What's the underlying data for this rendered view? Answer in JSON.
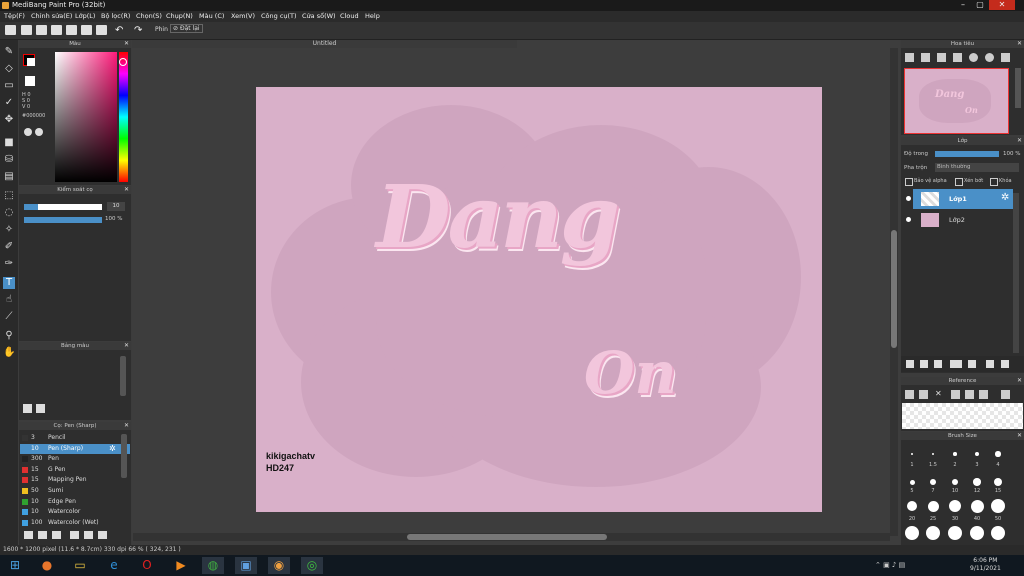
{
  "window": {
    "title": "MediBang Paint Pro (32bit)"
  },
  "menu": [
    "Tệp(F)",
    "Chỉnh sửa(E)",
    "Lớp(L)",
    "Bộ lọc(R)",
    "Chọn(S)",
    "Chụp(N)",
    "Màu (C)",
    "Xem(V)",
    "Công cụ(T)",
    "Cửa sổ(W)",
    "Cloud",
    "Help"
  ],
  "toolbar": {
    "prev_label": "Phin",
    "invert_label": "Đặt lại"
  },
  "document": {
    "tab_title": "Untitled"
  },
  "color_panel": {
    "title": "Màu",
    "hsv": [
      "H 0",
      "S 0",
      "V 0"
    ],
    "hex": "#000000",
    "colors": {
      "primary": "#000000",
      "secondary": "#ffffff",
      "accent": "#4a90c8"
    }
  },
  "brush_control": {
    "title": "Kiểm soát cọ",
    "size_value": "10",
    "opacity_value": "100 %"
  },
  "palette_panel": {
    "title": "Bảng màu"
  },
  "brush_panel": {
    "title": "Cọ: Pen (Sharp)",
    "items": [
      {
        "size": "3",
        "name": "Pencil",
        "color": "#333333"
      },
      {
        "size": "10",
        "name": "Pen (Sharp)",
        "color": "#4a90c8"
      },
      {
        "size": "300",
        "name": "Pen",
        "color": "#222222"
      },
      {
        "size": "15",
        "name": "G Pen",
        "color": "#e03030"
      },
      {
        "size": "15",
        "name": "Mapping Pen",
        "color": "#e03030"
      },
      {
        "size": "50",
        "name": "Sumi",
        "color": "#f0c020"
      },
      {
        "size": "10",
        "name": "Edge Pen",
        "color": "#30a030"
      },
      {
        "size": "10",
        "name": "Watercolor",
        "color": "#40a0e0"
      },
      {
        "size": "100",
        "name": "Watercolor (Wet)",
        "color": "#40a0e0"
      }
    ]
  },
  "canvas_art": {
    "title_line1": "Dang",
    "title_line2": "On",
    "watermark_line1": "kikigachatv",
    "watermark_line2": "HD247"
  },
  "navigator": {
    "title": "Hoa tiêu"
  },
  "layer_panel": {
    "title": "Lớp",
    "opacity_label": "Độ trong",
    "opacity_value": "100 %",
    "blend_label": "Pha trộn",
    "blend_value": "Bình thường",
    "protect_alpha": "Bảo vệ alpha",
    "clipping": "Xén bớt",
    "lock": "Khóa",
    "layers": [
      {
        "name": "Lớp1",
        "selected": true
      },
      {
        "name": "Lớp2",
        "selected": false
      }
    ]
  },
  "reference": {
    "title": "Reference"
  },
  "brush_size": {
    "title": "Brush Size",
    "labels": [
      "1",
      "1.5",
      "2",
      "3",
      "4",
      "5",
      "7",
      "10",
      "12",
      "15",
      "20",
      "25",
      "30",
      "40",
      "50"
    ]
  },
  "status": {
    "text": "1600 * 1200 pixel   (11.6 * 8.7cm)   330 dpi   66 %   ( 324, 231 )"
  },
  "taskbar": {
    "time": "6:06 PM",
    "date": "9/11/2021"
  }
}
